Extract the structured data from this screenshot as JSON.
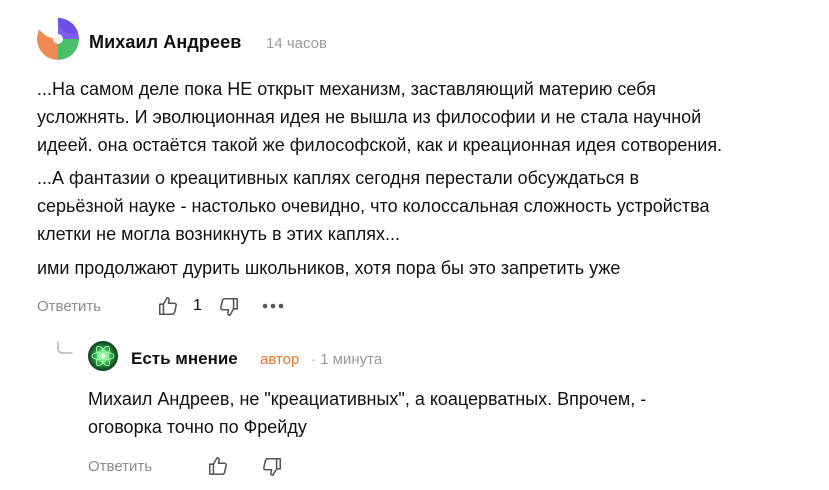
{
  "comment": {
    "author": "Михаил Андреев",
    "time": "14 часов",
    "paragraphs": [
      "...На самом деле пока НЕ открыт механизм, заставляющий материю себя\nусложнять. И эволюционная идея не вышла из философии и не стала научной\nидеей. она остаётся такой же философской, как и креационная идея сотворения.",
      "...А фантазии о креацитивных каплях сегодня перестали обсуждаться в\nсерьёзной науке - настолько очевидно, что колоссальная сложность устройства\nклетки не могла возникнуть в этих каплях...",
      "ими продолжают дурить школьников, хотя пора бы это запретить уже"
    ],
    "reply_label": "Ответить",
    "like_count": "1"
  },
  "reply": {
    "author": "Есть мнение",
    "badge": "автор",
    "time": "· 1 минута",
    "text": "Михаил Андреев, не \"креациативных\", а коацерватных. Впрочем, -\nоговорка точно по Фрейду",
    "reply_label": "Ответить"
  },
  "colors": {
    "badge": "#e8742e",
    "muted": "#8c8c8c",
    "avatar_purple": "#7b5cf0",
    "avatar_green": "#4cbf6b",
    "avatar_orange": "#f08a55",
    "avatar_reply_bg": "#0e3b1e",
    "avatar_reply_glow": "#5dff7a"
  },
  "icons": [
    "thumbs-up-icon",
    "thumbs-down-icon",
    "more-icon",
    "reply-thread-icon"
  ]
}
